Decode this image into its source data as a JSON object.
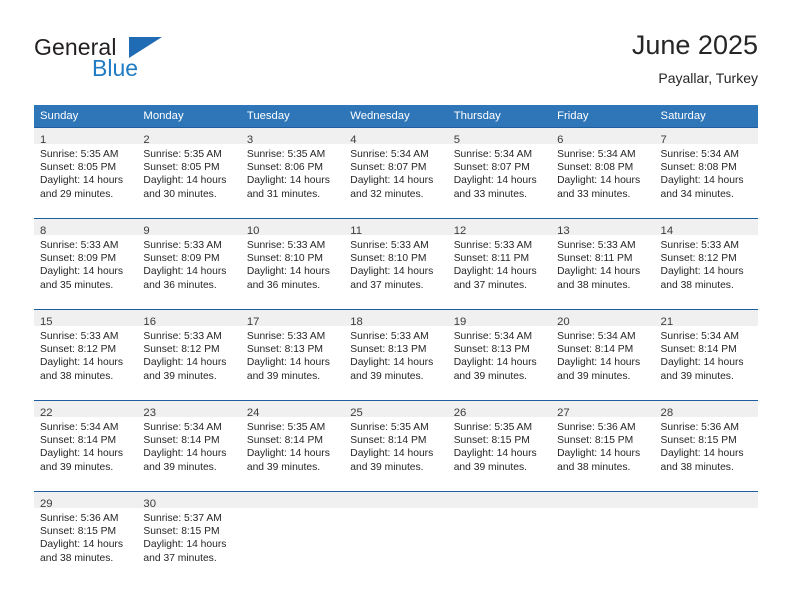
{
  "logo": {
    "text_primary": "General",
    "text_secondary": "Blue",
    "triangle_icon": "blue-triangle-icon",
    "primary_color": "#231f20",
    "secondary_color": "#1f7cc4"
  },
  "header": {
    "title": "June 2025",
    "subtitle": "Payallar, Turkey"
  },
  "theme": {
    "header_blue": "#2f76b8",
    "row_divider_blue": "#1f5fa0",
    "daynum_band_gray": "#f0f0f0",
    "text_color": "#262626"
  },
  "calendar": {
    "weekday_headers": [
      "Sunday",
      "Monday",
      "Tuesday",
      "Wednesday",
      "Thursday",
      "Friday",
      "Saturday"
    ],
    "weeks": [
      [
        {
          "day": "1",
          "sunrise": "Sunrise: 5:35 AM",
          "sunset": "Sunset: 8:05 PM",
          "daylight_line1": "Daylight: 14 hours",
          "daylight_line2": "and 29 minutes."
        },
        {
          "day": "2",
          "sunrise": "Sunrise: 5:35 AM",
          "sunset": "Sunset: 8:05 PM",
          "daylight_line1": "Daylight: 14 hours",
          "daylight_line2": "and 30 minutes."
        },
        {
          "day": "3",
          "sunrise": "Sunrise: 5:35 AM",
          "sunset": "Sunset: 8:06 PM",
          "daylight_line1": "Daylight: 14 hours",
          "daylight_line2": "and 31 minutes."
        },
        {
          "day": "4",
          "sunrise": "Sunrise: 5:34 AM",
          "sunset": "Sunset: 8:07 PM",
          "daylight_line1": "Daylight: 14 hours",
          "daylight_line2": "and 32 minutes."
        },
        {
          "day": "5",
          "sunrise": "Sunrise: 5:34 AM",
          "sunset": "Sunset: 8:07 PM",
          "daylight_line1": "Daylight: 14 hours",
          "daylight_line2": "and 33 minutes."
        },
        {
          "day": "6",
          "sunrise": "Sunrise: 5:34 AM",
          "sunset": "Sunset: 8:08 PM",
          "daylight_line1": "Daylight: 14 hours",
          "daylight_line2": "and 33 minutes."
        },
        {
          "day": "7",
          "sunrise": "Sunrise: 5:34 AM",
          "sunset": "Sunset: 8:08 PM",
          "daylight_line1": "Daylight: 14 hours",
          "daylight_line2": "and 34 minutes."
        }
      ],
      [
        {
          "day": "8",
          "sunrise": "Sunrise: 5:33 AM",
          "sunset": "Sunset: 8:09 PM",
          "daylight_line1": "Daylight: 14 hours",
          "daylight_line2": "and 35 minutes."
        },
        {
          "day": "9",
          "sunrise": "Sunrise: 5:33 AM",
          "sunset": "Sunset: 8:09 PM",
          "daylight_line1": "Daylight: 14 hours",
          "daylight_line2": "and 36 minutes."
        },
        {
          "day": "10",
          "sunrise": "Sunrise: 5:33 AM",
          "sunset": "Sunset: 8:10 PM",
          "daylight_line1": "Daylight: 14 hours",
          "daylight_line2": "and 36 minutes."
        },
        {
          "day": "11",
          "sunrise": "Sunrise: 5:33 AM",
          "sunset": "Sunset: 8:10 PM",
          "daylight_line1": "Daylight: 14 hours",
          "daylight_line2": "and 37 minutes."
        },
        {
          "day": "12",
          "sunrise": "Sunrise: 5:33 AM",
          "sunset": "Sunset: 8:11 PM",
          "daylight_line1": "Daylight: 14 hours",
          "daylight_line2": "and 37 minutes."
        },
        {
          "day": "13",
          "sunrise": "Sunrise: 5:33 AM",
          "sunset": "Sunset: 8:11 PM",
          "daylight_line1": "Daylight: 14 hours",
          "daylight_line2": "and 38 minutes."
        },
        {
          "day": "14",
          "sunrise": "Sunrise: 5:33 AM",
          "sunset": "Sunset: 8:12 PM",
          "daylight_line1": "Daylight: 14 hours",
          "daylight_line2": "and 38 minutes."
        }
      ],
      [
        {
          "day": "15",
          "sunrise": "Sunrise: 5:33 AM",
          "sunset": "Sunset: 8:12 PM",
          "daylight_line1": "Daylight: 14 hours",
          "daylight_line2": "and 38 minutes."
        },
        {
          "day": "16",
          "sunrise": "Sunrise: 5:33 AM",
          "sunset": "Sunset: 8:12 PM",
          "daylight_line1": "Daylight: 14 hours",
          "daylight_line2": "and 39 minutes."
        },
        {
          "day": "17",
          "sunrise": "Sunrise: 5:33 AM",
          "sunset": "Sunset: 8:13 PM",
          "daylight_line1": "Daylight: 14 hours",
          "daylight_line2": "and 39 minutes."
        },
        {
          "day": "18",
          "sunrise": "Sunrise: 5:33 AM",
          "sunset": "Sunset: 8:13 PM",
          "daylight_line1": "Daylight: 14 hours",
          "daylight_line2": "and 39 minutes."
        },
        {
          "day": "19",
          "sunrise": "Sunrise: 5:34 AM",
          "sunset": "Sunset: 8:13 PM",
          "daylight_line1": "Daylight: 14 hours",
          "daylight_line2": "and 39 minutes."
        },
        {
          "day": "20",
          "sunrise": "Sunrise: 5:34 AM",
          "sunset": "Sunset: 8:14 PM",
          "daylight_line1": "Daylight: 14 hours",
          "daylight_line2": "and 39 minutes."
        },
        {
          "day": "21",
          "sunrise": "Sunrise: 5:34 AM",
          "sunset": "Sunset: 8:14 PM",
          "daylight_line1": "Daylight: 14 hours",
          "daylight_line2": "and 39 minutes."
        }
      ],
      [
        {
          "day": "22",
          "sunrise": "Sunrise: 5:34 AM",
          "sunset": "Sunset: 8:14 PM",
          "daylight_line1": "Daylight: 14 hours",
          "daylight_line2": "and 39 minutes."
        },
        {
          "day": "23",
          "sunrise": "Sunrise: 5:34 AM",
          "sunset": "Sunset: 8:14 PM",
          "daylight_line1": "Daylight: 14 hours",
          "daylight_line2": "and 39 minutes."
        },
        {
          "day": "24",
          "sunrise": "Sunrise: 5:35 AM",
          "sunset": "Sunset: 8:14 PM",
          "daylight_line1": "Daylight: 14 hours",
          "daylight_line2": "and 39 minutes."
        },
        {
          "day": "25",
          "sunrise": "Sunrise: 5:35 AM",
          "sunset": "Sunset: 8:14 PM",
          "daylight_line1": "Daylight: 14 hours",
          "daylight_line2": "and 39 minutes."
        },
        {
          "day": "26",
          "sunrise": "Sunrise: 5:35 AM",
          "sunset": "Sunset: 8:15 PM",
          "daylight_line1": "Daylight: 14 hours",
          "daylight_line2": "and 39 minutes."
        },
        {
          "day": "27",
          "sunrise": "Sunrise: 5:36 AM",
          "sunset": "Sunset: 8:15 PM",
          "daylight_line1": "Daylight: 14 hours",
          "daylight_line2": "and 38 minutes."
        },
        {
          "day": "28",
          "sunrise": "Sunrise: 5:36 AM",
          "sunset": "Sunset: 8:15 PM",
          "daylight_line1": "Daylight: 14 hours",
          "daylight_line2": "and 38 minutes."
        }
      ],
      [
        {
          "day": "29",
          "sunrise": "Sunrise: 5:36 AM",
          "sunset": "Sunset: 8:15 PM",
          "daylight_line1": "Daylight: 14 hours",
          "daylight_line2": "and 38 minutes."
        },
        {
          "day": "30",
          "sunrise": "Sunrise: 5:37 AM",
          "sunset": "Sunset: 8:15 PM",
          "daylight_line1": "Daylight: 14 hours",
          "daylight_line2": "and 37 minutes."
        },
        {
          "day": "",
          "sunrise": "",
          "sunset": "",
          "daylight_line1": "",
          "daylight_line2": ""
        },
        {
          "day": "",
          "sunrise": "",
          "sunset": "",
          "daylight_line1": "",
          "daylight_line2": ""
        },
        {
          "day": "",
          "sunrise": "",
          "sunset": "",
          "daylight_line1": "",
          "daylight_line2": ""
        },
        {
          "day": "",
          "sunrise": "",
          "sunset": "",
          "daylight_line1": "",
          "daylight_line2": ""
        },
        {
          "day": "",
          "sunrise": "",
          "sunset": "",
          "daylight_line1": "",
          "daylight_line2": ""
        }
      ]
    ]
  }
}
